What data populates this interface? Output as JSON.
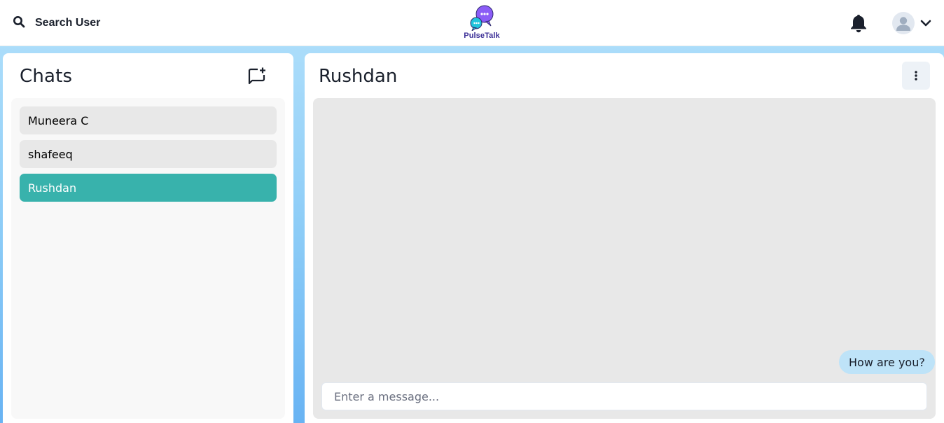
{
  "header": {
    "search_label": "Search User",
    "search_icon": "magnifier-icon",
    "logo_text": "PulseTalk",
    "bell_icon": "bell-icon",
    "avatar_icon": "user-avatar-icon",
    "chevron_icon": "chevron-down-icon"
  },
  "sidebar": {
    "title": "Chats",
    "new_chat_icon": "new-chat-icon",
    "items": [
      {
        "label": "Muneera C",
        "active": false
      },
      {
        "label": "shafeeq",
        "active": false
      },
      {
        "label": "Rushdan",
        "active": true
      }
    ]
  },
  "chat": {
    "recipient": "Rushdan",
    "menu_icon": "vertical-dots-icon",
    "messages": [
      {
        "text": "How are you?",
        "sender": "self"
      }
    ],
    "input_placeholder": "Enter a message...",
    "input_value": ""
  },
  "colors": {
    "active_item": "#38b2ac",
    "bubble_self": "#bee3f8",
    "logo_text": "#3b2e96",
    "background_gradient_top": "#b3e1fb",
    "background_gradient_bottom": "#68b3f3"
  }
}
